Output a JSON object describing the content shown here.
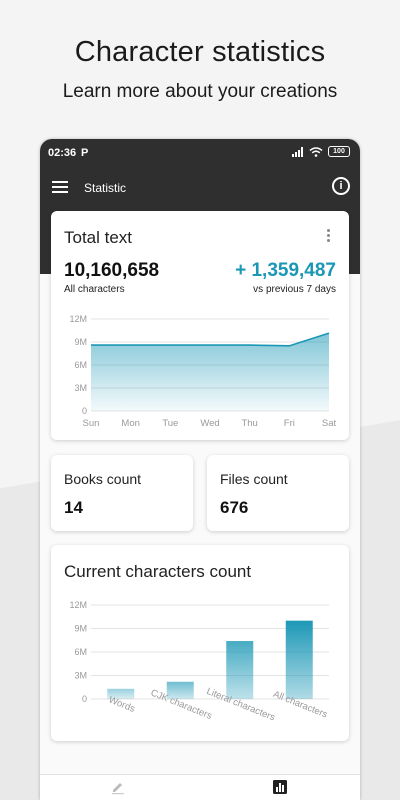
{
  "promo": {
    "title": "Character statistics",
    "subtitle": "Learn more about your creations"
  },
  "status_bar": {
    "time": "02:36",
    "notification": "P",
    "battery": "100"
  },
  "app_bar": {
    "title": "Statistic"
  },
  "total_text": {
    "title": "Total text",
    "value": "10,160,658",
    "value_caption": "All characters",
    "delta": "+ 1,359,487",
    "delta_caption": "vs previous 7 days",
    "delta_color": "#1b97b6"
  },
  "books": {
    "title": "Books count",
    "value": "14"
  },
  "files": {
    "title": "Files count",
    "value": "676"
  },
  "current": {
    "title": "Current characters count"
  },
  "colors": {
    "accent": "#1b97b6",
    "dark_header": "#2f2f2f"
  },
  "icons": [
    "menu-icon",
    "info-icon",
    "kebab-icon",
    "edit-icon",
    "bar-chart-icon"
  ],
  "chart_data": [
    {
      "type": "area",
      "x": [
        "Sun",
        "Mon",
        "Tue",
        "Wed",
        "Thu",
        "Fri",
        "Sat"
      ],
      "series": [
        {
          "values": [
            8.6,
            8.6,
            8.6,
            8.6,
            8.6,
            8.5,
            10.16
          ]
        }
      ],
      "yticks": [
        "0",
        "3M",
        "6M",
        "9M",
        "12M"
      ],
      "ylim": [
        0,
        12
      ],
      "unit": "M",
      "grid": true
    },
    {
      "type": "bar",
      "categories": [
        "Words",
        "CJK characters",
        "Literal characters",
        "All characters"
      ],
      "values": [
        1.3,
        2.2,
        7.4,
        10.0
      ],
      "yticks": [
        "0",
        "3M",
        "6M",
        "9M",
        "12M"
      ],
      "ylim": [
        0,
        12
      ],
      "unit": "M",
      "grid": true
    }
  ]
}
